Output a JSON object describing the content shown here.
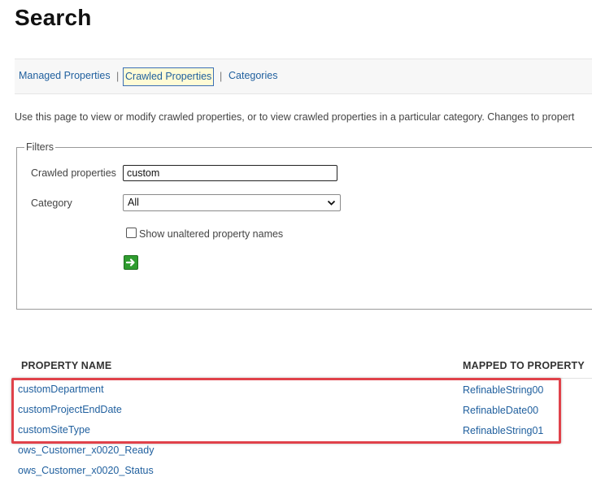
{
  "page": {
    "title": "Search"
  },
  "nav": {
    "managed_properties": "Managed Properties",
    "crawled_properties": "Crawled Properties",
    "categories": "Categories",
    "separator": "|"
  },
  "description": "Use this page to view or modify crawled properties, or to view crawled properties in a particular category. Changes to propert",
  "filters": {
    "legend": "Filters",
    "crawled_properties_label": "Crawled properties",
    "crawled_properties_value": "custom",
    "category_label": "Category",
    "category_value": "All",
    "show_unaltered_label": "Show unaltered property names",
    "show_unaltered_checked": false,
    "go_icon": "green-arrow-right-icon"
  },
  "table": {
    "headers": {
      "property_name": "PROPERTY NAME",
      "mapped_to_property": "MAPPED TO PROPERTY"
    },
    "rows": [
      {
        "name": "customDepartment",
        "mapped": "RefinableString00"
      },
      {
        "name": "customProjectEndDate",
        "mapped": "RefinableDate00"
      },
      {
        "name": "customSiteType",
        "mapped": "RefinableString01"
      },
      {
        "name": "ows_Customer_x0020_Ready",
        "mapped": ""
      },
      {
        "name": "ows_Customer_x0020_Status",
        "mapped": ""
      }
    ]
  },
  "colors": {
    "link": "#1f5f9e",
    "highlight": "#e0424a",
    "active_tab_bg": "#fffbd6",
    "go_button": "#2f9c2f"
  }
}
